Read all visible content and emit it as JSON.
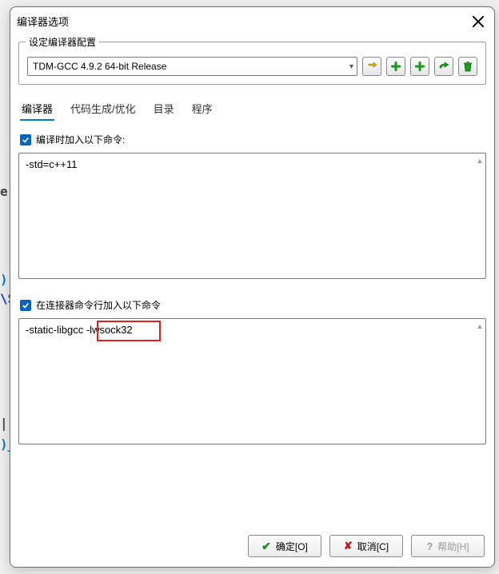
{
  "window": {
    "title": "编译器选项"
  },
  "group": {
    "legend": "设定编译器配置",
    "combo_value": "TDM-GCC 4.9.2 64-bit Release"
  },
  "toolbar_icons": {
    "swap": "swap-icon",
    "add1": "plus-icon",
    "add2": "plus-icon",
    "arrow": "forward-arrow-icon",
    "trash": "trash-icon"
  },
  "tabs": {
    "items": [
      {
        "label": "编译器",
        "active": true
      },
      {
        "label": "代码生成/优化",
        "active": false
      },
      {
        "label": "目录",
        "active": false
      },
      {
        "label": "程序",
        "active": false
      }
    ]
  },
  "section1": {
    "check_label": "编译时加入以下命令:",
    "checked": true,
    "text": "-std=c++11"
  },
  "section2": {
    "check_label": "在连接器命令行加入以下命令",
    "checked": true,
    "text": "-static-libgcc -lwsock32",
    "highlight_text": "-lwsock32"
  },
  "buttons": {
    "ok": "确定[O]",
    "cancel": "取消[C]",
    "help": "帮助[H]"
  },
  "edge_artifacts": {
    "e1": "e",
    "e2": ")",
    "e3": "\\S",
    "e4": "|",
    "e5": ")_"
  }
}
